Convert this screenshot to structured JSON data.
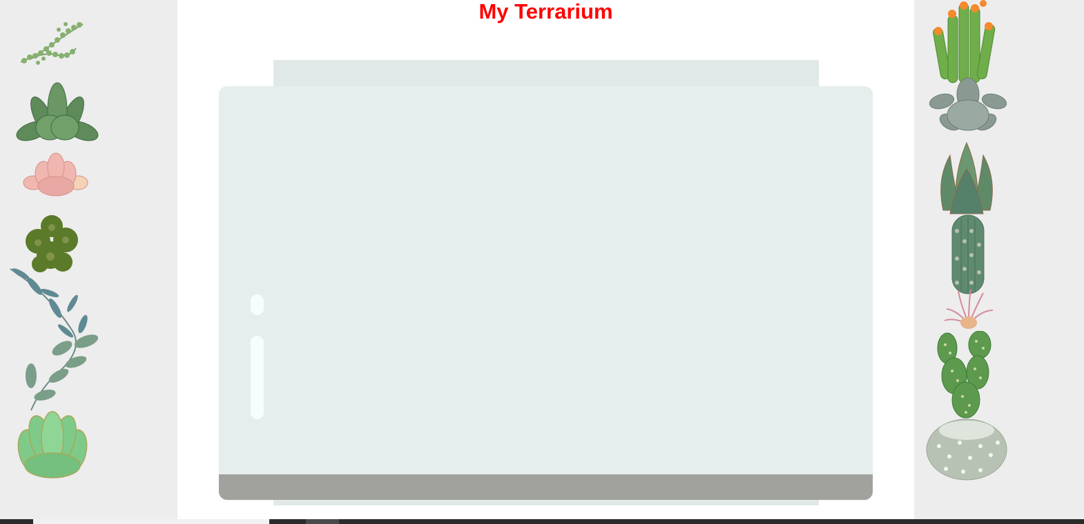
{
  "page": {
    "title": "My Terrarium"
  },
  "colors": {
    "title": "#ff0000",
    "side_panel": "#ededed",
    "jar_glass": "#e6eeed",
    "jar_rim": "#e0e9e8",
    "dirt": "#a1a19d",
    "taskbar": "#2b2b2b"
  },
  "left_plants": [
    "string-of-pearls-plant-icon",
    "green-rosette-succulent-icon",
    "pink-succulent-icon",
    "dark-green-cluster-succulent-icon",
    "eucalyptus-branch-plant-icon",
    "light-green-echeveria-icon"
  ],
  "right_plants": [
    "orange-flower-cactus-icon",
    "grey-rosette-succulent-icon",
    "aloe-succulent-icon",
    "columnar-cactus-icon",
    "air-plant-icon",
    "prickly-pear-cactus-icon",
    "round-white-cactus-icon"
  ]
}
